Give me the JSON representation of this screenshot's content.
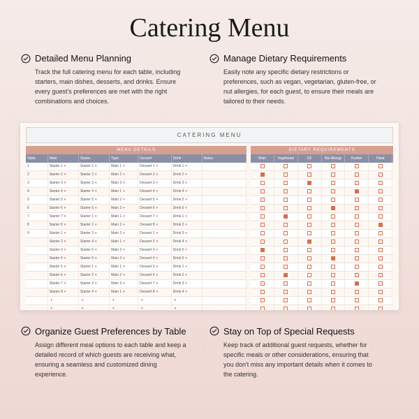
{
  "title": "Catering Menu",
  "features": [
    {
      "title": "Detailed Menu Planning",
      "body": "Track the full catering menu for each table, including starters, main dishes, desserts, and drinks. Ensure every guest's preferences are met with the right combinations and choices."
    },
    {
      "title": "Manage Dietary Requirements",
      "body": "Easily note any specific dietary restrictions or preferences, such as vegan, vegetarian, gluten-free, or nut allergies, for each guest, to ensure their meals are tailored to their needs."
    },
    {
      "title": "Organize Guest Preferences by Table",
      "body": "Assign different meal options to each table and keep a detailed record of which guests are receiving what, ensuring a seamless and customized dining experience."
    },
    {
      "title": "Stay on Top of Special Requests",
      "body": "Keep track of additional guest requests, whether for specific meals or other considerations, ensuring that you don't miss any important details when it comes to the catering."
    }
  ],
  "mockup": {
    "title": "CATERING MENU",
    "left": {
      "header": "MENU DETAILS",
      "cols": [
        "Table",
        "Main",
        "Starter",
        "Type",
        "Dessert",
        "Drink",
        "Notes"
      ],
      "rows": [
        [
          "1",
          "Starter 1",
          "Starter 1",
          "Main 1",
          "Dessert 1",
          "Drink 1",
          ""
        ],
        [
          "2",
          "Starter 2",
          "Starter 2",
          "Main 2",
          "Dessert 2",
          "Drink 2",
          ""
        ],
        [
          "3",
          "Starter 3",
          "Starter 3",
          "Main 3",
          "Dessert 3",
          "Drink 3",
          ""
        ],
        [
          "4",
          "Starter 4",
          "Starter 4",
          "Main 1",
          "Dessert 4",
          "Drink 4",
          ""
        ],
        [
          "5",
          "Starter 5",
          "Starter 5",
          "Main 2",
          "Dessert 5",
          "Drink 5",
          ""
        ],
        [
          "6",
          "Starter 6",
          "Starter 6",
          "Main 3",
          "Dessert 6",
          "Drink 6",
          ""
        ],
        [
          "7",
          "Starter 7",
          "Starter 1",
          "Main 1",
          "Dessert 7",
          "Drink 1",
          ""
        ],
        [
          "8",
          "Starter 8",
          "Starter 2",
          "Main 2",
          "Dessert 8",
          "Drink 2",
          ""
        ],
        [
          "9",
          "Starter 1",
          "Starter 3",
          "Main 3",
          "Dessert 1",
          "Drink 3",
          ""
        ],
        [
          "",
          "Starter 2",
          "Starter 4",
          "Main 1",
          "Dessert 2",
          "Drink 4",
          ""
        ],
        [
          "",
          "Starter 3",
          "Starter 5",
          "Main 2",
          "Dessert 3",
          "Drink 5",
          ""
        ],
        [
          "",
          "Starter 4",
          "Starter 6",
          "Main 3",
          "Dessert 4",
          "Drink 6",
          ""
        ],
        [
          "",
          "Starter 5",
          "Starter 1",
          "Main 1",
          "Dessert 5",
          "Drink 1",
          ""
        ],
        [
          "",
          "Starter 6",
          "Starter 2",
          "Main 2",
          "Dessert 6",
          "Drink 2",
          ""
        ],
        [
          "",
          "Starter 7",
          "Starter 3",
          "Main 3",
          "Dessert 7",
          "Drink 3",
          ""
        ],
        [
          "",
          "Starter 8",
          "Starter 4",
          "Main 1",
          "Dessert 8",
          "Drink 4",
          ""
        ],
        [
          "",
          "",
          "",
          "",
          "",
          "",
          ""
        ],
        [
          "",
          "",
          "",
          "",
          "",
          "",
          ""
        ],
        [
          "",
          "",
          "",
          "",
          "",
          "",
          ""
        ],
        [
          "",
          "",
          "",
          "",
          "",
          "",
          ""
        ],
        [
          "",
          "",
          "",
          "",
          "",
          "",
          ""
        ],
        [
          "",
          "",
          "",
          "",
          "",
          "",
          ""
        ],
        [
          "",
          "",
          "",
          "",
          "",
          "",
          ""
        ],
        [
          "",
          "",
          "",
          "",
          "",
          "",
          ""
        ],
        [
          "",
          "",
          "",
          "",
          "",
          "",
          ""
        ]
      ]
    },
    "right": {
      "header": "DIETARY REQUIREMENTS",
      "cols": [
        "Main",
        "Vegetarian",
        "GF",
        "Nut Allergy",
        "Kosher",
        "Halal"
      ],
      "rows": [
        [
          false,
          false,
          false,
          false,
          false,
          false
        ],
        [
          true,
          false,
          false,
          false,
          false,
          false
        ],
        [
          false,
          false,
          true,
          false,
          false,
          false
        ],
        [
          false,
          false,
          false,
          false,
          true,
          false
        ],
        [
          false,
          false,
          false,
          false,
          false,
          false
        ],
        [
          false,
          false,
          false,
          true,
          false,
          false
        ],
        [
          false,
          true,
          false,
          false,
          false,
          false
        ],
        [
          false,
          false,
          false,
          false,
          false,
          true
        ],
        [
          false,
          false,
          false,
          false,
          false,
          false
        ],
        [
          false,
          false,
          true,
          false,
          false,
          false
        ],
        [
          true,
          false,
          false,
          false,
          false,
          false
        ],
        [
          false,
          false,
          false,
          true,
          false,
          false
        ],
        [
          false,
          false,
          false,
          false,
          false,
          false
        ],
        [
          false,
          true,
          false,
          false,
          false,
          false
        ],
        [
          false,
          false,
          false,
          false,
          true,
          false
        ],
        [
          false,
          false,
          false,
          false,
          false,
          false
        ],
        [
          false,
          false,
          false,
          false,
          false,
          false
        ],
        [
          false,
          false,
          false,
          false,
          false,
          false
        ],
        [
          false,
          false,
          false,
          false,
          false,
          false
        ],
        [
          false,
          false,
          false,
          false,
          false,
          false
        ],
        [
          false,
          false,
          false,
          false,
          false,
          false
        ],
        [
          false,
          false,
          false,
          false,
          false,
          false
        ],
        [
          false,
          false,
          false,
          false,
          false,
          false
        ],
        [
          false,
          false,
          false,
          false,
          false,
          false
        ],
        [
          false,
          false,
          false,
          false,
          false,
          false
        ]
      ]
    }
  }
}
